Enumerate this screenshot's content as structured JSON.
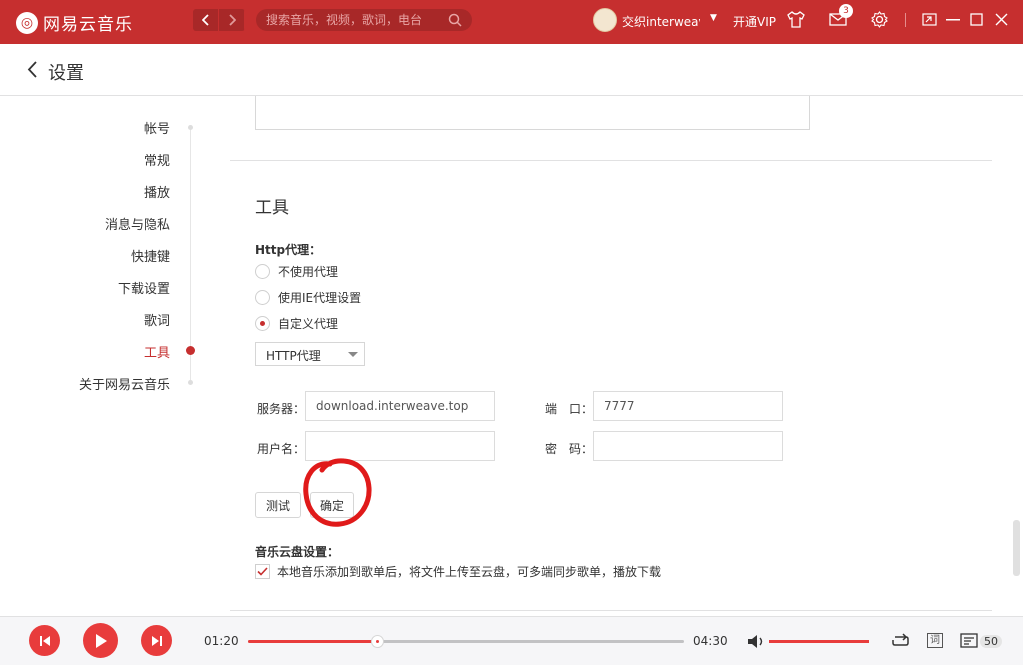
{
  "app": {
    "name": "网易云音乐"
  },
  "titlebar": {
    "search_placeholder": "搜索音乐，视频，歌词，电台",
    "username": "交织interweave",
    "vip_label": "开通VIP",
    "message_count": "3"
  },
  "header": {
    "title": "设置"
  },
  "sidebar": {
    "items": [
      {
        "label": "帐号"
      },
      {
        "label": "常规"
      },
      {
        "label": "播放"
      },
      {
        "label": "消息与隐私"
      },
      {
        "label": "快捷键"
      },
      {
        "label": "下载设置"
      },
      {
        "label": "歌词"
      },
      {
        "label": "工具"
      },
      {
        "label": "关于网易云音乐"
      }
    ],
    "active_item": "工具"
  },
  "tools": {
    "title": "工具",
    "proxy": {
      "label": "Http代理：",
      "options": [
        {
          "label": "不使用代理",
          "checked": false
        },
        {
          "label": "使用IE代理设置",
          "checked": false
        },
        {
          "label": "自定义代理",
          "checked": true
        }
      ],
      "type_selected": "HTTP代理",
      "server_label": "服务器：",
      "server_value": "download.interweave.top",
      "port_label": "端　口：",
      "port_value": "7777",
      "username_label": "用户名：",
      "username_value": "",
      "password_label": "密　码：",
      "password_value": "",
      "test_button": "测试",
      "confirm_button": "确定"
    },
    "cloud": {
      "label": "音乐云盘设置：",
      "option_label": "本地音乐添加到歌单后，将文件上传至云盘，可多端同步歌单，播放下载",
      "checked": true
    }
  },
  "player": {
    "current_time": "01:20",
    "total_time": "04:30",
    "progress_fraction": 0.296,
    "volume_fraction": 1.0,
    "lyric_label": "词",
    "playlist_count": "50"
  },
  "colors": {
    "accent": "#c62f2f",
    "player_red": "#e83c3c"
  }
}
